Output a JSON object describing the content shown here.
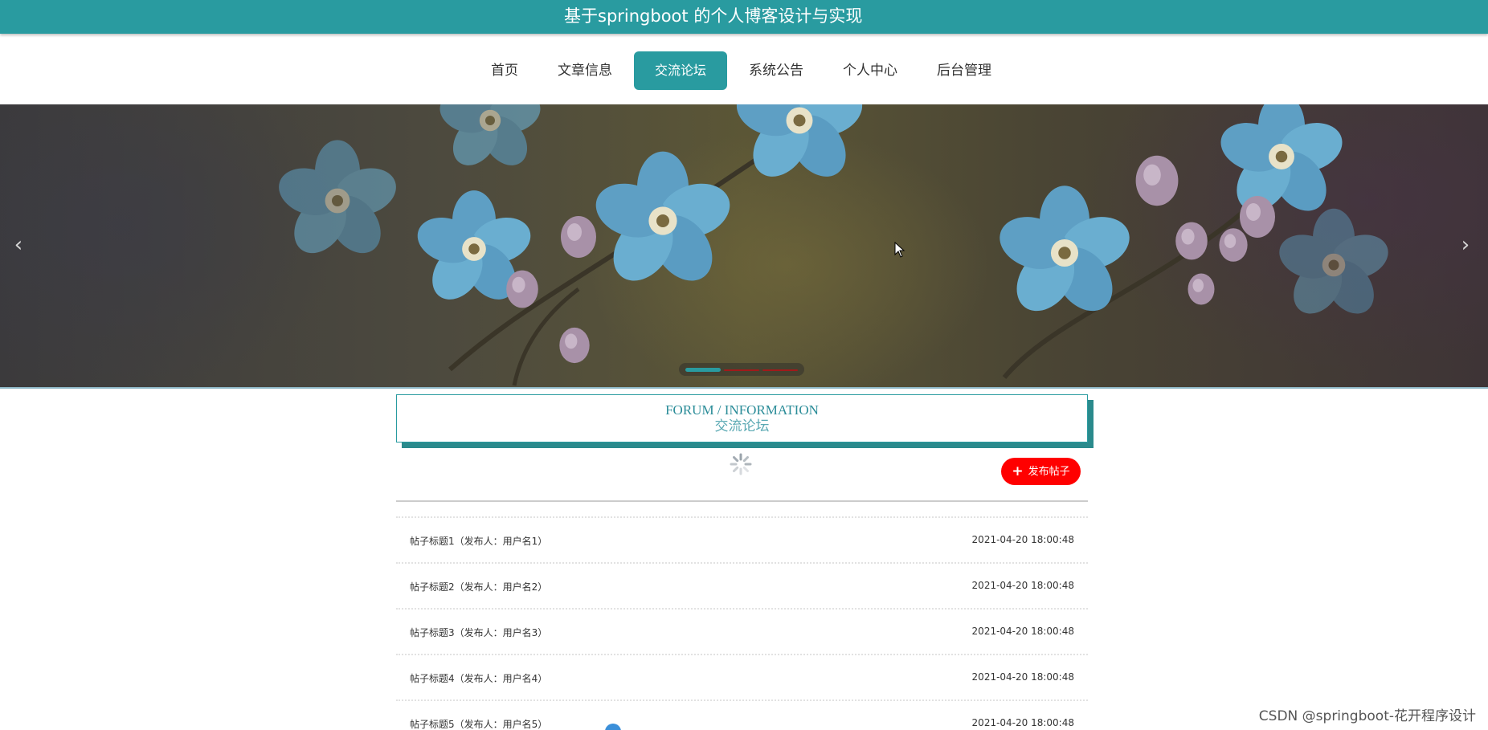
{
  "site": {
    "title": "基于springboot 的个人博客设计与实现"
  },
  "nav": {
    "items": [
      {
        "label": "首页",
        "active": false
      },
      {
        "label": "文章信息",
        "active": false
      },
      {
        "label": "交流论坛",
        "active": true
      },
      {
        "label": "系统公告",
        "active": false
      },
      {
        "label": "个人中心",
        "active": false
      },
      {
        "label": "后台管理",
        "active": false
      }
    ]
  },
  "banner": {
    "prev_icon": "chevron-left-icon",
    "next_icon": "chevron-right-icon",
    "prev_glyph": "‹",
    "next_glyph": "›",
    "active_slide": 1,
    "slide_count": 3,
    "active_dot_color": "#299ba0",
    "inactive_dot_color": "#a11a1a"
  },
  "section": {
    "title_en": "FORUM / INFORMATION",
    "title_cn": "交流论坛"
  },
  "actions": {
    "publish_label": "发布帖子",
    "publish_icon": "plus-icon",
    "loading_icon": "spinner-icon"
  },
  "posts": [
    {
      "title": "帖子标题1（发布人：用户名1）",
      "time": "2021-04-20 18:00:48"
    },
    {
      "title": "帖子标题2（发布人：用户名2）",
      "time": "2021-04-20 18:00:48"
    },
    {
      "title": "帖子标题3（发布人：用户名3）",
      "time": "2021-04-20 18:00:48"
    },
    {
      "title": "帖子标题4（发布人：用户名4）",
      "time": "2021-04-20 18:00:48"
    },
    {
      "title": "帖子标题5（发布人：用户名5）",
      "time": "2021-04-20 18:00:48"
    }
  ],
  "watermark": "CSDN @springboot-花开程序设计",
  "colors": {
    "accent": "#299ba0",
    "publish": "#ff0000"
  }
}
